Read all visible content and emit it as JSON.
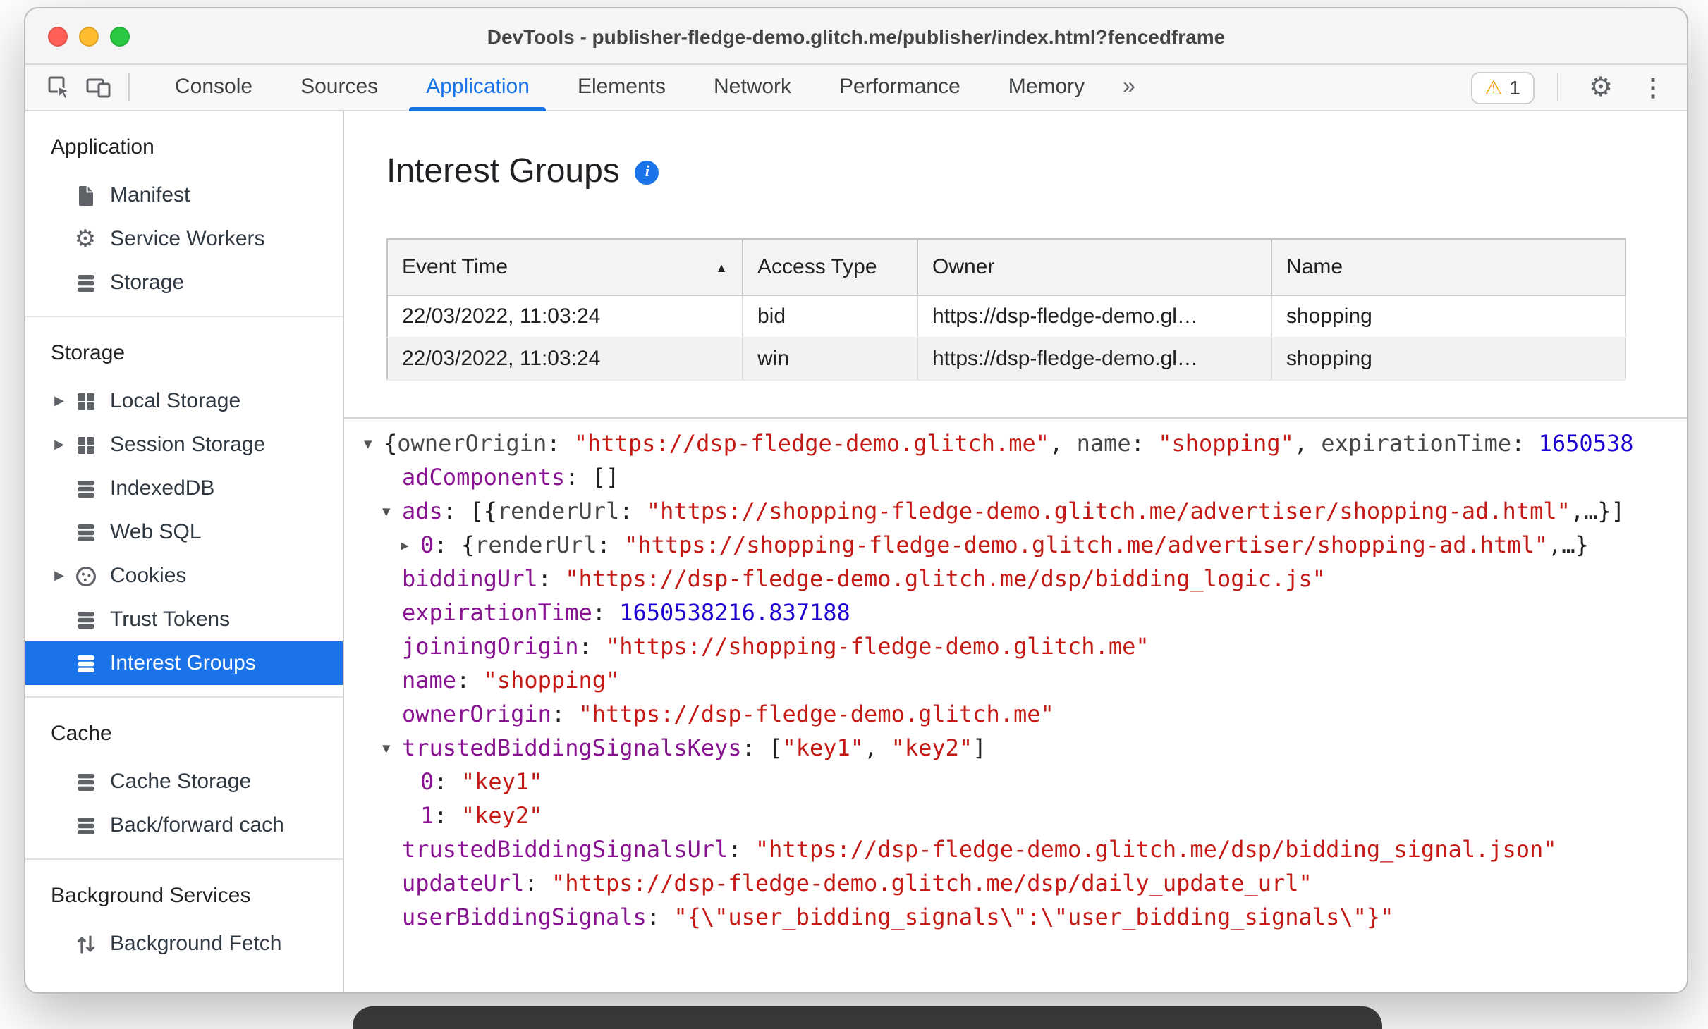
{
  "colors": {
    "accent_blue": "#1a73e8",
    "selection_blue": "#1a73e8",
    "property_purple": "#881391",
    "string_red": "#c41a16",
    "number_blue": "#1c00cf",
    "warning_orange": "#f29900"
  },
  "icons": {
    "more_tabs": "»",
    "warning": "⚠",
    "settings": "⚙",
    "overflow_menu": "⋮",
    "sort_ascending": "▲",
    "expander_open": "▼",
    "expander_closed": "▶",
    "info": "i"
  },
  "window": {
    "title": "DevTools - publisher-fledge-demo.glitch.me/publisher/index.html?fencedframe"
  },
  "toolbar": {
    "tabs": [
      "Console",
      "Sources",
      "Application",
      "Elements",
      "Network",
      "Performance",
      "Memory"
    ],
    "active_tab": "Application",
    "warning_count": "1"
  },
  "sidebar": {
    "sections": [
      {
        "title": "Application",
        "items": [
          {
            "label": "Manifest",
            "icon": "document"
          },
          {
            "label": "Service Workers",
            "icon": "gear"
          },
          {
            "label": "Storage",
            "icon": "database"
          }
        ]
      },
      {
        "title": "Storage",
        "items": [
          {
            "label": "Local Storage",
            "icon": "table",
            "expandable": true
          },
          {
            "label": "Session Storage",
            "icon": "table",
            "expandable": true
          },
          {
            "label": "IndexedDB",
            "icon": "database"
          },
          {
            "label": "Web SQL",
            "icon": "database"
          },
          {
            "label": "Cookies",
            "icon": "cookie",
            "expandable": true
          },
          {
            "label": "Trust Tokens",
            "icon": "database"
          },
          {
            "label": "Interest Groups",
            "icon": "database",
            "selected": true
          }
        ]
      },
      {
        "title": "Cache",
        "items": [
          {
            "label": "Cache Storage",
            "icon": "database"
          },
          {
            "label": "Back/forward cach",
            "icon": "database"
          }
        ]
      },
      {
        "title": "Background Services",
        "items": [
          {
            "label": "Background Fetch",
            "icon": "up-down-arrows"
          }
        ]
      }
    ]
  },
  "main": {
    "title": "Interest Groups",
    "table": {
      "columns": [
        "Event Time",
        "Access Type",
        "Owner",
        "Name"
      ],
      "sort_column": "Event Time",
      "sort_direction": "ascending",
      "rows": [
        [
          "22/03/2022, 11:03:24",
          "bid",
          "https://dsp-fledge-demo.gl…",
          "shopping"
        ],
        [
          "22/03/2022, 11:03:24",
          "win",
          "https://dsp-fledge-demo.gl…",
          "shopping"
        ]
      ]
    },
    "tree": {
      "lines": [
        {
          "exp": "open",
          "indent": 0,
          "tokens": [
            {
              "c": "p",
              "t": "{"
            },
            {
              "c": "pk",
              "t": "ownerOrigin"
            },
            {
              "c": "p",
              "t": ": "
            },
            {
              "c": "s",
              "t": "\"https://dsp-fledge-demo.glitch.me\""
            },
            {
              "c": "p",
              "t": ", "
            },
            {
              "c": "pk",
              "t": "name"
            },
            {
              "c": "p",
              "t": ": "
            },
            {
              "c": "s",
              "t": "\"shopping\""
            },
            {
              "c": "p",
              "t": ", "
            },
            {
              "c": "pk",
              "t": "expirationTime"
            },
            {
              "c": "p",
              "t": ": "
            },
            {
              "c": "n",
              "t": "1650538"
            }
          ]
        },
        {
          "exp": null,
          "indent": 1,
          "tokens": [
            {
              "c": "k",
              "t": "adComponents"
            },
            {
              "c": "p",
              "t": ": "
            },
            {
              "c": "p",
              "t": "[]"
            }
          ]
        },
        {
          "exp": "open",
          "indent": 1,
          "tokens": [
            {
              "c": "k",
              "t": "ads"
            },
            {
              "c": "p",
              "t": ": "
            },
            {
              "c": "p",
              "t": "[{"
            },
            {
              "c": "pk",
              "t": "renderUrl"
            },
            {
              "c": "p",
              "t": ": "
            },
            {
              "c": "s",
              "t": "\"https://shopping-fledge-demo.glitch.me/advertiser/shopping-ad.html\""
            },
            {
              "c": "p",
              "t": ",…}]"
            }
          ]
        },
        {
          "exp": "closed",
          "indent": 2,
          "tokens": [
            {
              "c": "k",
              "t": "0"
            },
            {
              "c": "p",
              "t": ": "
            },
            {
              "c": "p",
              "t": "{"
            },
            {
              "c": "pk",
              "t": "renderUrl"
            },
            {
              "c": "p",
              "t": ": "
            },
            {
              "c": "s",
              "t": "\"https://shopping-fledge-demo.glitch.me/advertiser/shopping-ad.html\""
            },
            {
              "c": "p",
              "t": ",…}"
            }
          ]
        },
        {
          "exp": null,
          "indent": 1,
          "tokens": [
            {
              "c": "k",
              "t": "biddingUrl"
            },
            {
              "c": "p",
              "t": ": "
            },
            {
              "c": "s",
              "t": "\"https://dsp-fledge-demo.glitch.me/dsp/bidding_logic.js\""
            }
          ]
        },
        {
          "exp": null,
          "indent": 1,
          "tokens": [
            {
              "c": "k",
              "t": "expirationTime"
            },
            {
              "c": "p",
              "t": ": "
            },
            {
              "c": "n",
              "t": "1650538216.837188"
            }
          ]
        },
        {
          "exp": null,
          "indent": 1,
          "tokens": [
            {
              "c": "k",
              "t": "joiningOrigin"
            },
            {
              "c": "p",
              "t": ": "
            },
            {
              "c": "s",
              "t": "\"https://shopping-fledge-demo.glitch.me\""
            }
          ]
        },
        {
          "exp": null,
          "indent": 1,
          "tokens": [
            {
              "c": "k",
              "t": "name"
            },
            {
              "c": "p",
              "t": ": "
            },
            {
              "c": "s",
              "t": "\"shopping\""
            }
          ]
        },
        {
          "exp": null,
          "indent": 1,
          "tokens": [
            {
              "c": "k",
              "t": "ownerOrigin"
            },
            {
              "c": "p",
              "t": ": "
            },
            {
              "c": "s",
              "t": "\"https://dsp-fledge-demo.glitch.me\""
            }
          ]
        },
        {
          "exp": "open",
          "indent": 1,
          "tokens": [
            {
              "c": "k",
              "t": "trustedBiddingSignalsKeys"
            },
            {
              "c": "p",
              "t": ": "
            },
            {
              "c": "p",
              "t": "["
            },
            {
              "c": "s",
              "t": "\"key1\""
            },
            {
              "c": "p",
              "t": ", "
            },
            {
              "c": "s",
              "t": "\"key2\""
            },
            {
              "c": "p",
              "t": "]"
            }
          ]
        },
        {
          "exp": null,
          "indent": 2,
          "tokens": [
            {
              "c": "k",
              "t": "0"
            },
            {
              "c": "p",
              "t": ": "
            },
            {
              "c": "s",
              "t": "\"key1\""
            }
          ]
        },
        {
          "exp": null,
          "indent": 2,
          "tokens": [
            {
              "c": "k",
              "t": "1"
            },
            {
              "c": "p",
              "t": ": "
            },
            {
              "c": "s",
              "t": "\"key2\""
            }
          ]
        },
        {
          "exp": null,
          "indent": 1,
          "tokens": [
            {
              "c": "k",
              "t": "trustedBiddingSignalsUrl"
            },
            {
              "c": "p",
              "t": ": "
            },
            {
              "c": "s",
              "t": "\"https://dsp-fledge-demo.glitch.me/dsp/bidding_signal.json\""
            }
          ]
        },
        {
          "exp": null,
          "indent": 1,
          "tokens": [
            {
              "c": "k",
              "t": "updateUrl"
            },
            {
              "c": "p",
              "t": ": "
            },
            {
              "c": "s",
              "t": "\"https://dsp-fledge-demo.glitch.me/dsp/daily_update_url\""
            }
          ]
        },
        {
          "exp": null,
          "indent": 1,
          "tokens": [
            {
              "c": "k",
              "t": "userBiddingSignals"
            },
            {
              "c": "p",
              "t": ": "
            },
            {
              "c": "s",
              "t": "\"{\\\"user_bidding_signals\\\":\\\"user_bidding_signals\\\"}\""
            }
          ]
        }
      ]
    }
  }
}
